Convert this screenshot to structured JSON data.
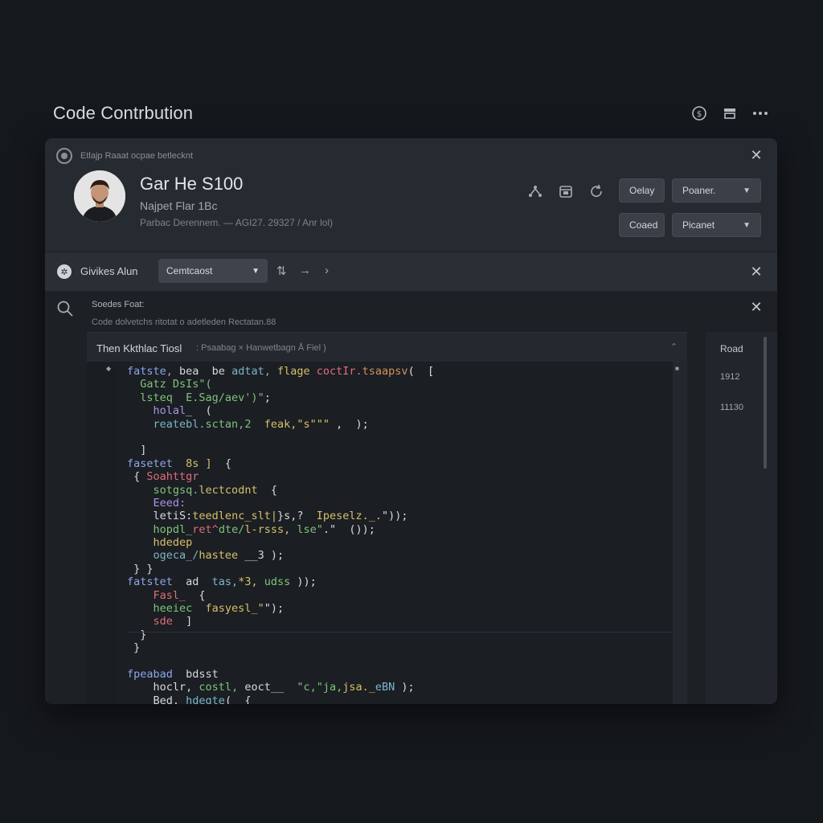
{
  "page": {
    "title": "Code Contrbution",
    "top_icons": [
      "dollar-circle-icon",
      "inbox-icon",
      "more-icon"
    ]
  },
  "profile_panel": {
    "header_text": "Etlajp Raaat ocpae betlecknt",
    "name": "Gar He S100",
    "subtitle": "Najpet Flar 1Bc",
    "meta": "Parbac Derennem. — AGI27. 29327 / Anr lol)",
    "icons": [
      "branch-icon",
      "calendar-icon",
      "refresh-icon"
    ],
    "buttons": {
      "delay": "Oelay",
      "closed": "Coaed",
      "dropdown1": "Poaner.",
      "dropdown2": "Picanet"
    }
  },
  "toolbar": {
    "label": "Givikes Alun",
    "select_value": "Cemtcaost"
  },
  "code_section": {
    "title": "Soedes Foat:",
    "description": "Code dolvetchs ritotat o adetleden Rectatan.88",
    "tab_title": "Then Kkthlac Tiosl",
    "tab_path": ": Psaabag × Hanwetbagn Å Fiel )",
    "side_label": "Road",
    "side_values": [
      "1912",
      "11130"
    ],
    "code_lines": [
      [
        [
          "k",
          "fatste, "
        ],
        [
          "p",
          "bea  be "
        ],
        [
          "c",
          "adtat, "
        ],
        [
          "y",
          "flage "
        ],
        [
          "r",
          "coctIr."
        ],
        [
          "o",
          "tsaapsv"
        ],
        [
          "p",
          "(  ["
        ]
      ],
      [
        [
          "p",
          "  "
        ],
        [
          "s",
          "Gatz DsIs\"("
        ]
      ],
      [
        [
          "p",
          "  "
        ],
        [
          "s",
          "lsteq  E.Sag/aev')\""
        ],
        [
          "p",
          ";"
        ]
      ],
      [
        [
          "p",
          "    "
        ],
        [
          "f",
          "holal"
        ],
        [
          "p",
          "_  ("
        ]
      ],
      [
        [
          "p",
          "    "
        ],
        [
          "c",
          "reatebl."
        ],
        [
          "s",
          "sctan,2  "
        ],
        [
          "y",
          "feak,\"s\"\"\" "
        ],
        [
          "p",
          ",  );"
        ]
      ],
      [
        [
          "p",
          " "
        ]
      ],
      [
        [
          "p",
          "  ]"
        ]
      ],
      [
        [
          "k",
          "fasetet  "
        ],
        [
          "y",
          "8s ]"
        ],
        [
          "p",
          "  {"
        ]
      ],
      [
        [
          "p",
          " { "
        ],
        [
          "r",
          "Soahttgr"
        ]
      ],
      [
        [
          "p",
          "    "
        ],
        [
          "s",
          "sotgsq."
        ],
        [
          "y",
          "lectcodnt"
        ],
        [
          "p",
          "  {"
        ]
      ],
      [
        [
          "p",
          "    "
        ],
        [
          "f",
          "Eeed:"
        ]
      ],
      [
        [
          "p",
          "    "
        ],
        [
          "p",
          "letiS:"
        ],
        [
          "y",
          "teedlenc_slt|"
        ],
        [
          "p",
          "}s,?  "
        ],
        [
          "y",
          "Ipeselz._."
        ],
        [
          "p",
          "\"));"
        ]
      ],
      [
        [
          "p",
          "    "
        ],
        [
          "s",
          "hopdl_"
        ],
        [
          "r",
          "ret^"
        ],
        [
          "s",
          "dte/"
        ],
        [
          "y",
          "l-rsss,"
        ],
        [
          "p",
          " "
        ],
        [
          "s",
          "lse\""
        ],
        [
          "p",
          ".\"  ());"
        ]
      ],
      [
        [
          "p",
          "    "
        ],
        [
          "y",
          "hdedep"
        ]
      ],
      [
        [
          "p",
          "    "
        ],
        [
          "c",
          "ogeca_/"
        ],
        [
          "y",
          "hastee"
        ],
        [
          "p",
          " __3 );"
        ]
      ],
      [
        [
          "p",
          " } }"
        ]
      ],
      [
        [
          "k",
          "fatstet  "
        ],
        [
          "p",
          "ad  "
        ],
        [
          "c",
          "tas,"
        ],
        [
          "y",
          "*3, "
        ],
        [
          "s",
          "udss"
        ],
        [
          "p",
          " ));"
        ]
      ],
      [
        [
          "p",
          "    "
        ],
        [
          "r",
          "Fasl_"
        ],
        [
          "p",
          "  {"
        ]
      ],
      [
        [
          "p",
          "    "
        ],
        [
          "s",
          "heeiec  "
        ],
        [
          "y",
          "fasyesl_\""
        ],
        [
          "p",
          "\");"
        ]
      ],
      [
        [
          "p",
          "    "
        ],
        [
          "r",
          "sde"
        ],
        [
          "p",
          "  ]"
        ]
      ],
      [
        [
          "p",
          "  }"
        ]
      ],
      [
        [
          "p",
          " }"
        ]
      ],
      [
        [
          "p",
          " "
        ]
      ],
      [
        [
          "k",
          "fpeabad  "
        ],
        [
          "p",
          "bdsst"
        ]
      ],
      [
        [
          "p",
          "    "
        ],
        [
          "p",
          "hoclr,"
        ],
        [
          "s",
          " costl, "
        ],
        [
          "p",
          "eoct__  "
        ],
        [
          "s",
          "\"c,\"ja,"
        ],
        [
          "y",
          "jsa._"
        ],
        [
          "c",
          "eBN"
        ],
        [
          "p",
          " );"
        ]
      ],
      [
        [
          "p",
          "    "
        ],
        [
          "p",
          "Bed. "
        ],
        [
          "c",
          "hdegte"
        ],
        [
          "p",
          "(  {"
        ]
      ]
    ]
  }
}
